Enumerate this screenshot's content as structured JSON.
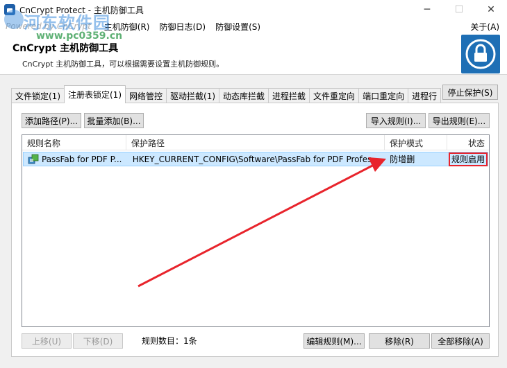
{
  "window": {
    "title": "CnCrypt Protect - 主机防御工具",
    "minimize_glyph": "─",
    "maximize_glyph": "☐",
    "close_glyph": "✕"
  },
  "menubar": {
    "powered": "Powered by CnCrypt",
    "items": [
      "主机防御(R)",
      "防御日志(D)",
      "防御设置(S)"
    ],
    "about": "关于(A)"
  },
  "watermark": {
    "text": "河东软件园",
    "url": "www.pc0359.cn"
  },
  "header": {
    "title": "CnCrypt 主机防御工具",
    "description": "CnCrypt 主机防御工具，可以根据需要设置主机防御规则。",
    "icon": "lock-icon"
  },
  "tabs": [
    "文件锁定(1)",
    "注册表锁定(1)",
    "网络管控",
    "驱动拦截(1)",
    "动态库拦截",
    "进程拦截",
    "文件重定向",
    "端口重定向",
    "进程行"
  ],
  "active_tab_index": 1,
  "stop_protect_label": "停止保护(S)",
  "toolbar": {
    "add_path": "添加路径(P)...",
    "batch_add": "批量添加(B)...",
    "import_rules": "导入规则(I)...",
    "export_rules": "导出规则(E)..."
  },
  "list": {
    "columns": [
      "规则名称",
      "保护路径",
      "保护模式",
      "状态"
    ],
    "rows": [
      {
        "name": "PassFab for PDF P...",
        "path": "HKEY_CURRENT_CONFIG\\Software\\PassFab for PDF Profes...",
        "mode": "防增删",
        "status": "规则启用"
      }
    ]
  },
  "bottom": {
    "move_up": "上移(U)",
    "move_down": "下移(D)",
    "count_label": "规则数目：1条",
    "edit_rule": "编辑规则(M)...",
    "remove": "移除(R)",
    "remove_all": "全部移除(A)"
  },
  "colors": {
    "accent": "#1e6fb5",
    "selection": "#cce8ff",
    "highlight_red": "#e8242c"
  }
}
